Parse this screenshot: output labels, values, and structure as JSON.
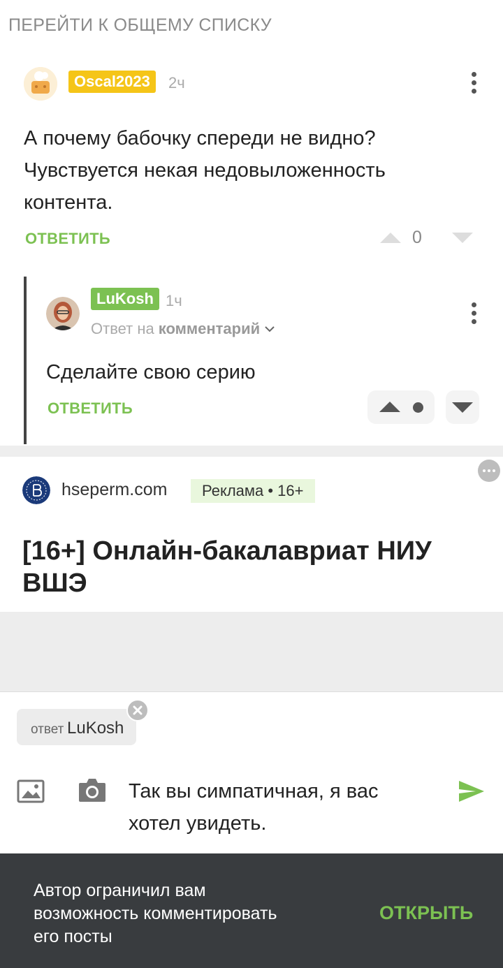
{
  "nav": {
    "back_label": "ПЕРЕЙТИ К ОБЩЕМУ СПИСКУ"
  },
  "comment": {
    "author": "Oscal2023",
    "author_color": "#f5c518",
    "time": "2ч",
    "text_line1": "А почему бабочку спереди не видно?",
    "text_line2": "Чувствуется некая недовыложенность",
    "text_line3": "контента.",
    "reply_label": "ОТВЕТИТЬ",
    "rating": "0"
  },
  "reply": {
    "author": "LuKosh",
    "author_color": "#7cc152",
    "time": "1ч",
    "reply_to_prefix": "Ответ на",
    "reply_to_target": "комментарий",
    "text": "Сделайте свою серию",
    "reply_label": "ОТВЕТИТЬ"
  },
  "ad": {
    "domain": "hseperm.com",
    "tag": "Реклама • 16+",
    "title_line1": "[16+] Онлайн-бакалавриат НИУ",
    "title_line2": "ВШЭ"
  },
  "composer": {
    "reply_chip_prefix": "ответ",
    "reply_chip_name": "LuKosh",
    "text_line1": "Так вы симпатичная, я вас",
    "text_line2": "хотел увидеть."
  },
  "notice": {
    "line1": "Автор ограничил вам",
    "line2": "возможность комментировать",
    "line3": "его посты",
    "action_label": "ОТКРЫТЬ"
  },
  "colors": {
    "accent_green": "#7cc152",
    "bar_bg": "#393c3f"
  }
}
